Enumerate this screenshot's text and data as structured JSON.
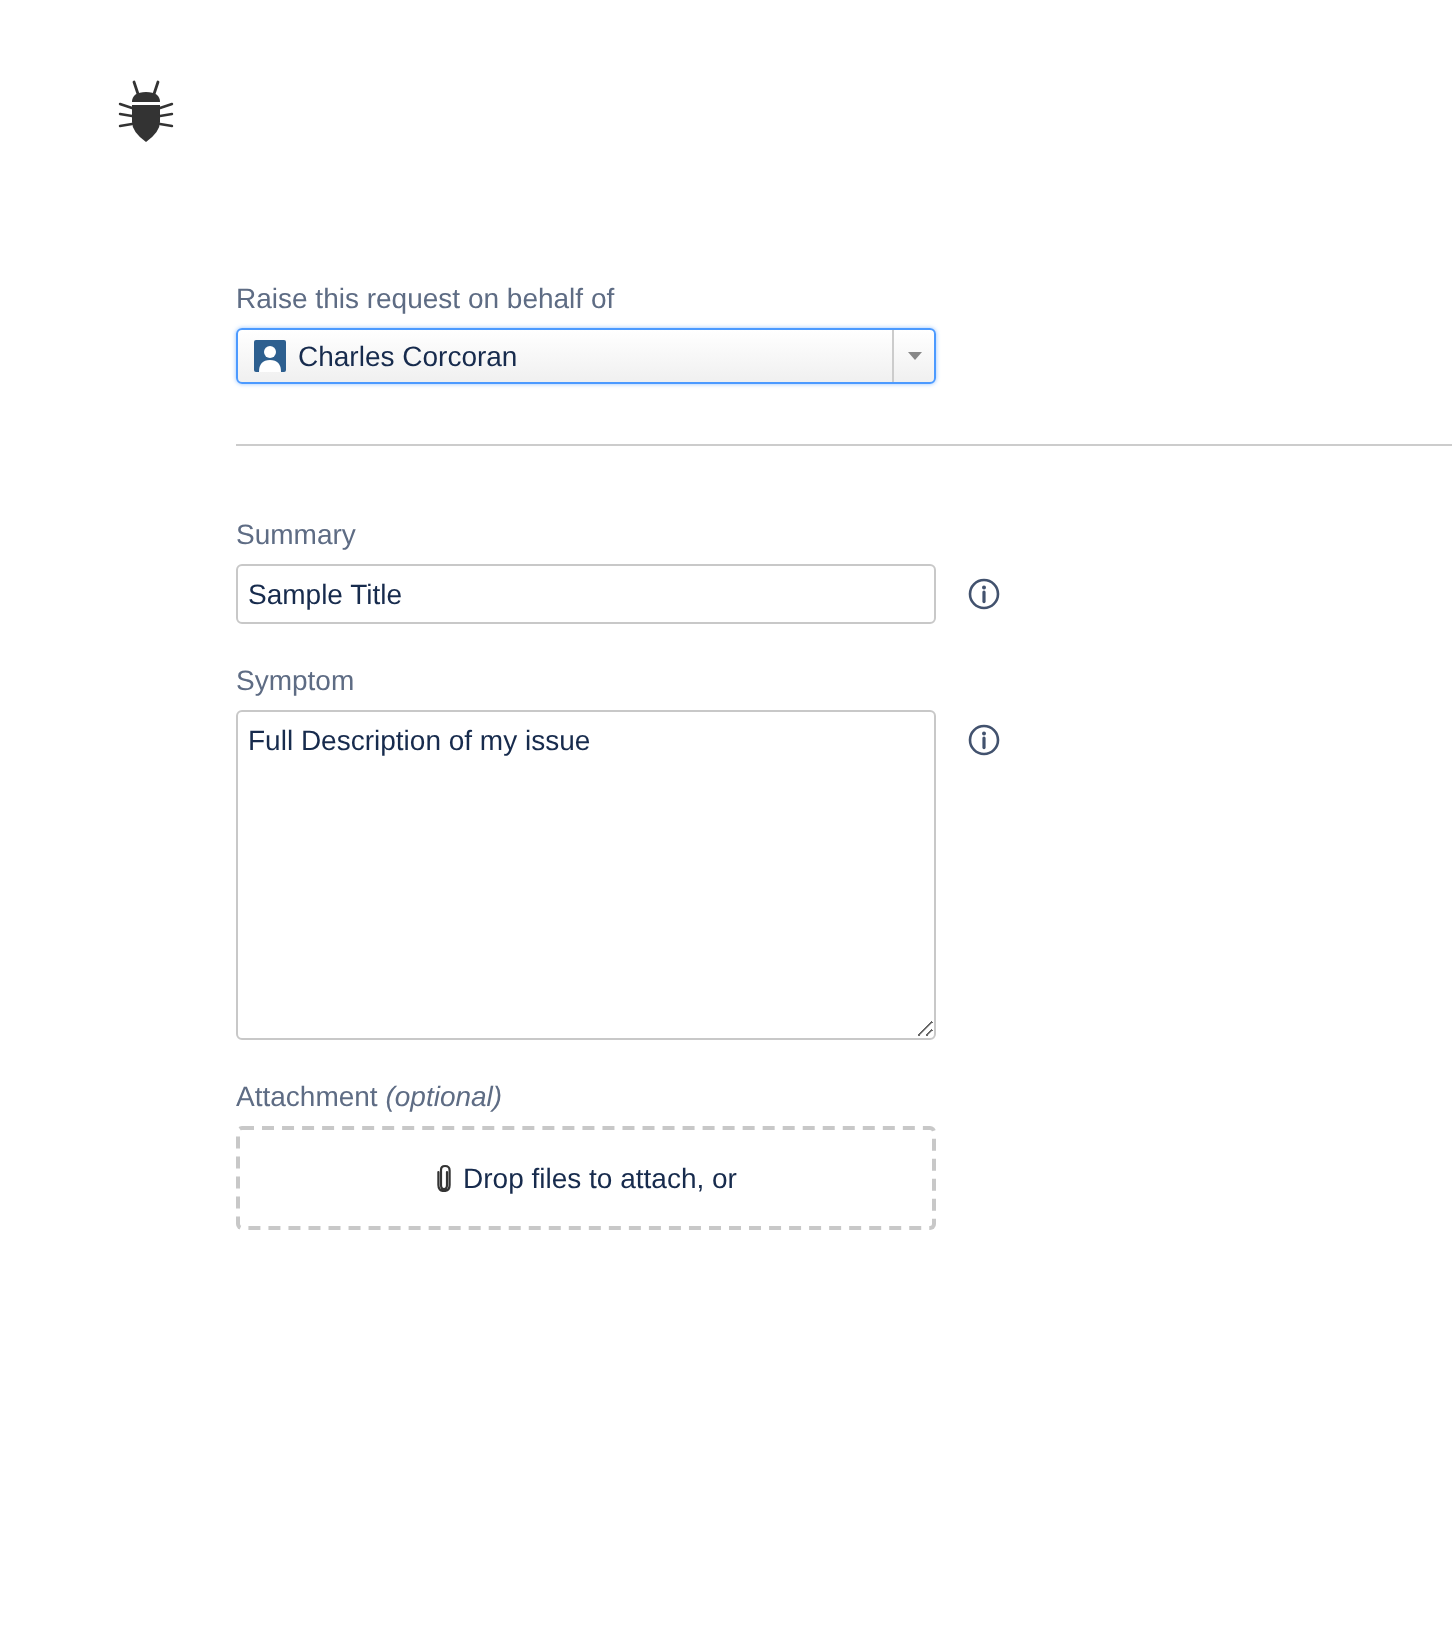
{
  "requester": {
    "label": "Raise this request on behalf of",
    "value": "Charles Corcoran"
  },
  "fields": [
    {
      "kind": "text",
      "label": "Summary",
      "value": "Sample Title",
      "info": true
    },
    {
      "kind": "textarea",
      "label": "Symptom",
      "value": "Full Description of my issue",
      "info": true
    }
  ],
  "attachment": {
    "label": "Attachment *(optional)*",
    "prompt": "Drop files to attach, or"
  }
}
